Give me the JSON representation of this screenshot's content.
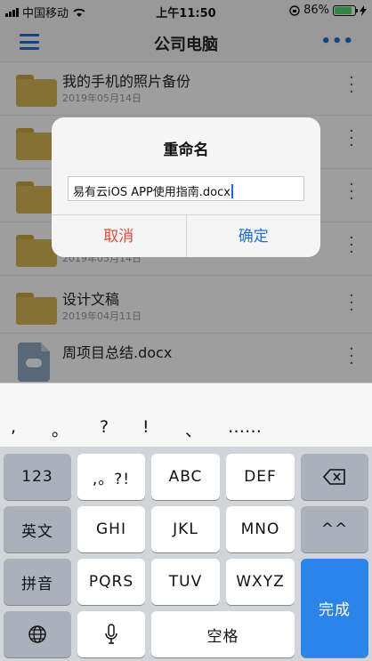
{
  "status": {
    "carrier": "中国移动",
    "time": "上午11:50",
    "battery": "86%"
  },
  "nav": {
    "title": "公司电脑"
  },
  "files": [
    {
      "name": "我的手机的照片备份",
      "date": "2019年05月14日",
      "type": "folder"
    },
    {
      "name": "",
      "date": "",
      "type": "folder"
    },
    {
      "name": "",
      "date": "",
      "type": "folder"
    },
    {
      "name": "",
      "date": "2019年05月14日",
      "type": "folder"
    },
    {
      "name": "设计文稿",
      "date": "2019年04月11日",
      "type": "folder"
    },
    {
      "name": "周项目总结.docx",
      "date": "",
      "type": "document"
    }
  ],
  "dialog": {
    "title": "重命名",
    "input_value": "易有云iOS APP使用指南.docx",
    "cancel": "取消",
    "confirm": "确定"
  },
  "keyboard": {
    "candidates": [
      ",",
      "。",
      "?",
      "!",
      "、",
      "……"
    ],
    "row1": [
      "123",
      ",。?!",
      "ABC",
      "DEF"
    ],
    "row2": [
      "英文",
      "GHI",
      "JKL",
      "MNO",
      "^^"
    ],
    "row3": [
      "拼音",
      "PQRS",
      "TUV",
      "WXYZ"
    ],
    "done": "完成",
    "space": "空格"
  },
  "icons": {
    "menu": "hamburger-icon",
    "more": "ellipsis-icon",
    "delete": "backspace-icon",
    "globe": "globe-icon",
    "mic": "microphone-icon"
  },
  "colors": {
    "accent": "#1e6fd9",
    "cancel": "#e64b3c",
    "done_key": "#2a84ea",
    "folder": "#d9b654"
  }
}
